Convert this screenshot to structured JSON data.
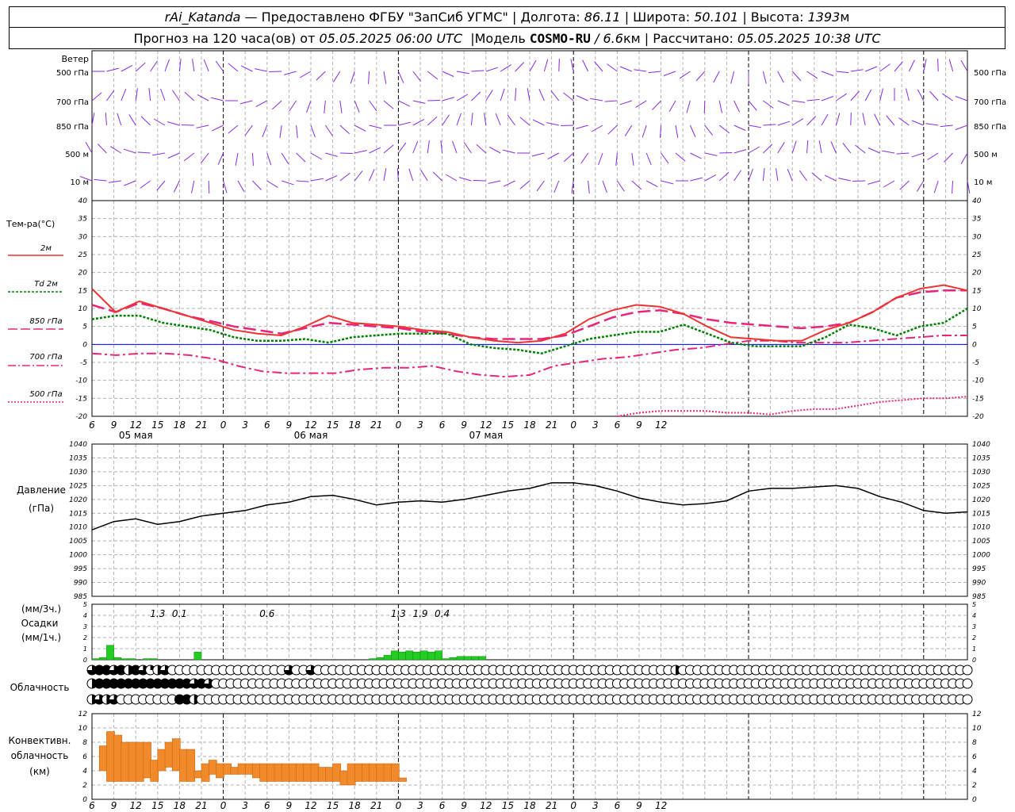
{
  "header": {
    "station": "rAi_Katanda",
    "dash": "—",
    "provider": "Предоставлено ФГБУ \"ЗапСиб УГМС\"",
    "sep": "|",
    "lon_label": "Долгота:",
    "lon_value": "86.11",
    "lat_label": "Широта:",
    "lat_value": "50.101",
    "alt_label": "Высота:",
    "alt_value": "1393",
    "alt_unit": "м",
    "forecast_label": "Прогноз на 120 часа(ов) от",
    "forecast_from": "05.05.2025 06:00 UTC",
    "model_label": "Модель",
    "model_name": "COSMO-RU",
    "model_res": "/ 6.6",
    "model_res_unit": "км",
    "calc_label": "Рассчитано:",
    "calc_time": "05.05.2025 10:38 UTC"
  },
  "colors": {
    "wind": "#8a2be2",
    "t2m": "#ee3333",
    "td2m": "#008000",
    "t850": "#e8257a",
    "t700": "#e8257a",
    "t500": "#e8257a",
    "pressure": "#000000",
    "precip": "#22cc22",
    "conv": "#f08a2a",
    "zero_line": "#0000ff"
  },
  "chart_data": [
    {
      "type": "wind_barbs",
      "title": "Ветер",
      "levels": [
        "500 гПа",
        "700 гПа",
        "850 гПа",
        "500 м",
        "10 м"
      ]
    },
    {
      "type": "line",
      "title": "Тем-ра(°C)",
      "ylim": [
        -20,
        40
      ],
      "yticks": [
        -20,
        -15,
        -10,
        -5,
        0,
        5,
        10,
        15,
        20,
        25,
        30,
        35,
        40
      ],
      "x_hours": [
        0,
        3,
        6,
        9,
        12,
        15,
        18,
        21,
        24,
        27,
        30,
        33,
        36,
        39,
        42,
        45,
        48,
        51,
        54,
        57,
        60,
        63,
        66,
        69,
        72,
        75,
        78,
        81,
        84,
        87,
        90,
        93,
        96,
        99,
        102,
        105,
        108,
        111,
        114,
        117,
        120
      ],
      "series": [
        {
          "name": "2м",
          "values": [
            15.5,
            9,
            12,
            10,
            8,
            6,
            4,
            3,
            2.5,
            5,
            8,
            6,
            5.5,
            5,
            4,
            3.5,
            2,
            1,
            0.5,
            1,
            3,
            7,
            9.5,
            11,
            10.5,
            8.5,
            5,
            2,
            1.5,
            1,
            1,
            4,
            6,
            9,
            13,
            15.5,
            16.5,
            15
          ]
        },
        {
          "name": "Td 2м",
          "values": [
            7,
            8,
            8,
            6,
            5,
            4,
            2,
            1,
            1,
            1.5,
            0.5,
            2,
            2.5,
            3,
            3,
            3,
            0,
            -1,
            -1.5,
            -2.5,
            -0.5,
            1.5,
            2.5,
            3.5,
            3.5,
            5.5,
            3,
            0.5,
            -0.5,
            -0.5,
            -0.5,
            2,
            5.5,
            4.5,
            2.5,
            5,
            6,
            10
          ]
        },
        {
          "name": "850 гПа",
          "values": [
            11,
            9,
            11.5,
            10,
            8,
            6.5,
            5,
            4,
            3,
            4.5,
            6,
            5.5,
            5,
            4.5,
            3.5,
            3,
            2,
            1.5,
            1.5,
            1.5,
            2.5,
            5,
            7.5,
            9,
            9.5,
            8.5,
            7,
            6,
            5.5,
            5,
            4.5,
            5,
            6,
            9,
            13,
            14.5,
            15,
            15
          ]
        },
        {
          "name": "700 гПа",
          "values": [
            -2.5,
            -3,
            -2.5,
            -2.5,
            -3,
            -4,
            -6,
            -7.5,
            -8,
            -8,
            -8,
            -7,
            -6.5,
            -6.5,
            -6,
            -7.5,
            -8.5,
            -9,
            -8.5,
            -6,
            -5,
            -4,
            -3.5,
            -2.5,
            -1.5,
            -1,
            0,
            1,
            1,
            0.5,
            0.5,
            0.5,
            1,
            1.5,
            2,
            2.5,
            2.5
          ]
        },
        {
          "name": "500 гПа",
          "values": [
            -20,
            -19,
            -18.5,
            -18.5,
            -18.5,
            -19,
            -19,
            -19.5,
            -18.5,
            -18,
            -18,
            -17,
            -16,
            -15.5,
            -15,
            -15,
            -14.5
          ]
        }
      ]
    },
    {
      "type": "line",
      "title": "Давление",
      "ylabel": "(гПа)",
      "ylim": [
        985,
        1040
      ],
      "yticks": [
        985,
        990,
        995,
        1000,
        1005,
        1010,
        1015,
        1020,
        1025,
        1030,
        1035,
        1040
      ],
      "series": [
        {
          "name": "Давление",
          "values": [
            1009,
            1012,
            1013,
            1011,
            1012,
            1014,
            1015,
            1016,
            1018,
            1019,
            1021,
            1021.5,
            1020,
            1018,
            1019,
            1019.5,
            1019,
            1020,
            1021.5,
            1023,
            1024,
            1026,
            1026,
            1025,
            1023,
            1020.5,
            1019,
            1018,
            1018.5,
            1019.5,
            1023,
            1024,
            1024,
            1024.5,
            1025,
            1024,
            1021,
            1019,
            1016,
            1015,
            1015.5
          ]
        }
      ]
    },
    {
      "type": "bar",
      "title": "Осадки",
      "ylabel_1": "(мм/3ч.)",
      "ylabel_2": "(мм/1ч.)",
      "ylim": [
        0,
        5
      ],
      "yticks": [
        0,
        1,
        2,
        3,
        4,
        5
      ],
      "labels": [
        "1.3",
        "0.1",
        "0.6",
        "1.3",
        "1.9",
        "0.4"
      ],
      "hourly": [
        0.1,
        0.2,
        1.3,
        0.2,
        0.1,
        0.1,
        0.0,
        0.1,
        0.1,
        0.0,
        0.0,
        0.0,
        0.0,
        0.0,
        0.7,
        0.0,
        0.0,
        0.0,
        0.0,
        0.0,
        0.0,
        0.0,
        0.0,
        0.0,
        0.0,
        0.0,
        0.0,
        0.0,
        0.0,
        0.0,
        0.0,
        0.0,
        0.0,
        0.0,
        0.0,
        0.0,
        0.0,
        0.0,
        0.1,
        0.2,
        0.4,
        0.8,
        0.7,
        0.8,
        0.7,
        0.8,
        0.7,
        0.8,
        0.1,
        0.2,
        0.3,
        0.3,
        0.3,
        0.3
      ]
    },
    {
      "type": "cloud_cover",
      "title": "Облачность",
      "rows": [
        [
          3,
          4,
          4,
          3,
          4,
          2,
          4,
          3,
          1,
          2,
          3,
          0,
          0,
          0,
          0,
          0,
          0,
          0,
          0,
          0,
          0,
          0,
          0,
          0,
          0,
          0,
          0,
          3,
          0,
          0,
          3,
          0,
          0,
          0,
          0,
          0,
          0,
          0,
          0,
          0,
          0,
          0,
          0,
          0,
          0,
          0,
          0,
          0,
          0,
          0,
          0,
          0,
          0,
          0,
          0,
          0,
          0,
          0,
          0,
          0,
          0,
          0,
          0,
          0,
          0,
          0,
          0,
          0,
          0,
          0,
          0,
          0,
          0,
          0,
          0,
          0,
          0,
          0,
          0,
          0,
          2,
          0,
          0,
          0,
          0,
          0,
          0,
          0,
          0,
          0,
          0,
          0,
          0,
          0,
          0,
          0,
          0,
          0,
          0,
          0,
          0,
          0,
          0,
          0,
          0,
          0,
          0,
          0,
          0,
          0,
          0,
          0,
          0,
          0,
          0,
          0,
          0,
          0,
          0,
          0,
          0
        ],
        [
          2,
          4,
          4,
          4,
          4,
          4,
          4,
          4,
          4,
          4,
          4,
          4,
          4,
          4,
          3,
          4,
          3,
          0,
          0,
          0,
          0,
          0,
          0,
          0,
          0,
          0,
          0,
          0,
          0,
          0,
          0,
          0,
          0,
          0,
          0,
          0,
          0,
          0,
          0,
          0,
          0,
          0,
          0,
          0,
          0,
          0,
          0,
          0,
          0,
          0,
          0,
          0,
          0,
          0,
          0,
          0,
          0,
          0,
          0,
          0,
          0,
          0,
          0,
          0,
          0,
          0,
          0,
          0,
          0,
          0,
          0,
          0,
          0,
          0,
          0,
          0,
          0,
          0,
          0,
          0,
          0,
          0,
          0,
          0,
          0,
          0,
          0,
          0,
          0,
          0,
          0,
          0,
          0,
          0,
          0,
          0,
          0,
          0,
          0,
          0,
          0,
          0,
          0,
          0,
          0,
          0,
          0,
          0,
          0,
          0,
          0,
          0,
          0,
          0,
          0,
          0,
          0,
          0,
          0,
          0,
          0
        ],
        [
          2,
          3,
          2,
          3,
          0,
          0,
          0,
          0,
          0,
          0,
          0,
          0,
          4,
          4,
          2,
          0,
          0,
          0,
          0,
          0,
          0,
          0,
          0,
          0,
          0,
          0,
          0,
          0,
          0,
          0,
          0,
          0,
          0,
          0,
          0,
          0,
          0,
          0,
          0,
          0,
          0,
          0,
          0,
          0,
          0,
          0,
          0,
          0,
          0,
          0,
          0,
          0,
          0,
          0,
          0,
          0,
          0,
          0,
          0,
          0,
          0,
          0,
          0,
          0,
          0,
          0,
          0,
          0,
          0,
          0,
          0,
          0,
          0,
          0,
          0,
          0,
          0,
          0,
          0,
          0,
          0,
          0,
          0,
          0,
          0,
          0,
          0,
          0,
          0,
          0,
          0,
          0,
          0,
          0,
          0,
          0,
          0,
          0,
          0,
          0,
          0,
          0,
          0,
          0,
          0,
          0,
          0,
          0,
          0,
          0,
          0,
          0,
          0,
          0,
          0,
          0,
          0,
          0,
          0,
          0,
          0
        ]
      ]
    },
    {
      "type": "bar",
      "title": "Конвективн. облачность",
      "ylabel": "(км)",
      "ylim": [
        0,
        12
      ],
      "yticks": [
        0,
        2,
        4,
        6,
        8,
        10,
        12
      ],
      "bases": [
        4,
        2.5,
        2.5,
        2.5,
        2.5,
        2.5,
        3,
        2.5,
        4,
        4.5,
        4,
        2.5,
        2.5,
        3,
        2.5,
        3.5,
        3,
        3.5,
        3.5,
        3.5,
        3.5,
        3,
        2.5,
        2.5,
        2.5,
        2.5,
        2.5,
        2.5,
        2.5,
        2.5,
        2.5,
        2.5,
        2.5,
        2,
        2,
        2.5,
        2.5,
        2.5,
        2.5,
        2.5,
        2.5,
        2.5
      ],
      "tops": [
        7.5,
        9.5,
        9,
        8,
        8,
        8,
        8,
        5.5,
        7,
        8,
        8.5,
        7,
        7,
        4,
        5,
        5.5,
        5,
        5,
        4.5,
        5,
        5,
        5,
        5,
        5,
        5,
        5,
        5,
        5,
        5,
        5,
        4.5,
        4.5,
        5,
        4,
        5,
        5,
        5,
        5,
        5,
        5,
        5,
        3
      ]
    }
  ],
  "axis": {
    "hour_ticks": [
      "6",
      "9",
      "12",
      "15",
      "18",
      "21",
      "0",
      "3",
      "6",
      "9",
      "12",
      "15",
      "18",
      "21",
      "0",
      "3",
      "6",
      "9",
      "12",
      "15",
      "18",
      "21",
      "0",
      "3",
      "6",
      "9",
      "12"
    ],
    "dates": [
      "05 мая",
      "06 мая",
      "07 мая"
    ]
  },
  "legend": {
    "t2m": "2м",
    "td_a": "Td",
    "td_b": "2м",
    "t850": "850 гПа",
    "t700": "700 гПа",
    "t500": "500 гПа"
  }
}
